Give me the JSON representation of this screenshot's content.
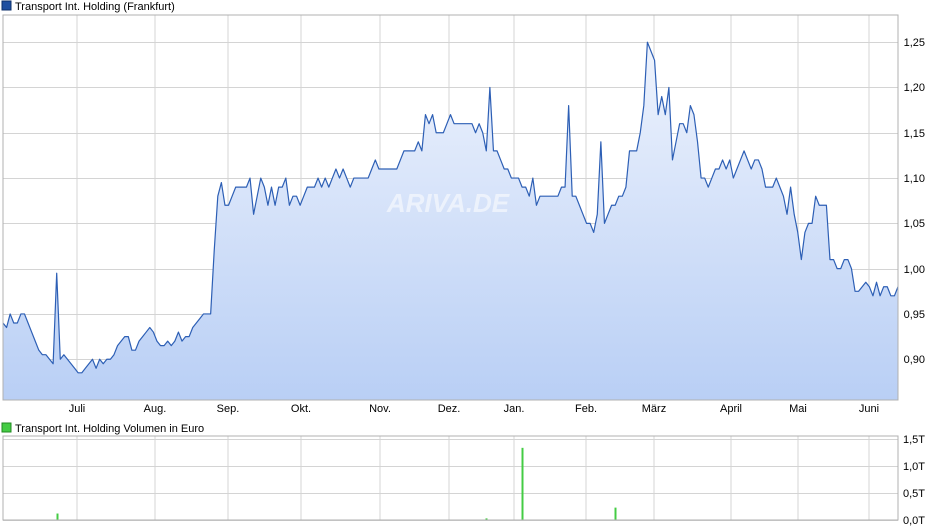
{
  "watermark": "ARIVA.DE",
  "chart_data": [
    {
      "type": "area",
      "title": "Transport Int. Holding (Frankfurt)",
      "xlabel": "",
      "ylabel": "",
      "month_labels": [
        "Juli",
        "Aug.",
        "Sep.",
        "Okt.",
        "Nov.",
        "Dez.",
        "Jan.",
        "Feb.",
        "März",
        "April",
        "Mai",
        "Juni"
      ],
      "y_tick_labels": [
        "0,90",
        "0,95",
        "1,00",
        "1,05",
        "1,10",
        "1,15",
        "1,20",
        "1,25"
      ],
      "y_ticks": [
        0.9,
        0.95,
        1.0,
        1.05,
        1.1,
        1.15,
        1.2,
        1.25
      ],
      "ylim": [
        0.855,
        1.28
      ],
      "grid": true,
      "legend_position": "top-left",
      "colors": {
        "line": "#2d5fb5",
        "fill_top": "#eef3fd",
        "fill_bottom": "#b9cff5",
        "legend": "#1f4fa0"
      },
      "series": [
        {
          "name": "Transport Int. Holding (Frankfurt)",
          "values": [
            0.94,
            0.935,
            0.95,
            0.94,
            0.94,
            0.95,
            0.95,
            0.94,
            0.93,
            0.92,
            0.91,
            0.905,
            0.905,
            0.9,
            0.895,
            0.995,
            0.9,
            0.905,
            0.9,
            0.895,
            0.89,
            0.885,
            0.885,
            0.89,
            0.895,
            0.9,
            0.89,
            0.9,
            0.895,
            0.9,
            0.9,
            0.905,
            0.915,
            0.92,
            0.925,
            0.925,
            0.91,
            0.91,
            0.92,
            0.925,
            0.93,
            0.935,
            0.93,
            0.92,
            0.915,
            0.915,
            0.92,
            0.915,
            0.92,
            0.93,
            0.92,
            0.925,
            0.925,
            0.935,
            0.94,
            0.945,
            0.95,
            0.95,
            0.95,
            1.02,
            1.08,
            1.095,
            1.07,
            1.07,
            1.08,
            1.09,
            1.09,
            1.09,
            1.09,
            1.1,
            1.06,
            1.08,
            1.1,
            1.09,
            1.07,
            1.09,
            1.07,
            1.09,
            1.09,
            1.1,
            1.07,
            1.08,
            1.08,
            1.07,
            1.08,
            1.09,
            1.09,
            1.09,
            1.1,
            1.09,
            1.1,
            1.09,
            1.1,
            1.11,
            1.1,
            1.11,
            1.1,
            1.09,
            1.1,
            1.1,
            1.1,
            1.1,
            1.1,
            1.11,
            1.12,
            1.11,
            1.11,
            1.11,
            1.11,
            1.11,
            1.11,
            1.12,
            1.13,
            1.13,
            1.13,
            1.13,
            1.14,
            1.13,
            1.17,
            1.16,
            1.17,
            1.15,
            1.15,
            1.15,
            1.16,
            1.17,
            1.16,
            1.16,
            1.16,
            1.16,
            1.16,
            1.16,
            1.15,
            1.16,
            1.15,
            1.13,
            1.2,
            1.13,
            1.13,
            1.12,
            1.11,
            1.11,
            1.1,
            1.1,
            1.1,
            1.09,
            1.09,
            1.08,
            1.1,
            1.07,
            1.08,
            1.08,
            1.08,
            1.08,
            1.08,
            1.08,
            1.09,
            1.09,
            1.18,
            1.08,
            1.08,
            1.07,
            1.06,
            1.05,
            1.05,
            1.04,
            1.06,
            1.14,
            1.05,
            1.06,
            1.07,
            1.07,
            1.08,
            1.08,
            1.09,
            1.13,
            1.13,
            1.13,
            1.15,
            1.18,
            1.25,
            1.24,
            1.23,
            1.17,
            1.19,
            1.17,
            1.2,
            1.12,
            1.14,
            1.16,
            1.16,
            1.15,
            1.18,
            1.17,
            1.14,
            1.1,
            1.1,
            1.09,
            1.1,
            1.11,
            1.11,
            1.12,
            1.11,
            1.12,
            1.1,
            1.11,
            1.12,
            1.13,
            1.12,
            1.11,
            1.12,
            1.12,
            1.11,
            1.09,
            1.09,
            1.09,
            1.1,
            1.09,
            1.08,
            1.06,
            1.09,
            1.06,
            1.04,
            1.01,
            1.04,
            1.05,
            1.05,
            1.08,
            1.07,
            1.07,
            1.07,
            1.01,
            1.01,
            1.0,
            1.0,
            1.01,
            1.01,
            1.0,
            0.975,
            0.975,
            0.98,
            0.985,
            0.98,
            0.97,
            0.985,
            0.97,
            0.98,
            0.98,
            0.97,
            0.97,
            0.98
          ]
        }
      ]
    },
    {
      "type": "bar",
      "title": "Transport Int. Holding Volumen in Euro",
      "xlabel": "",
      "ylabel": "",
      "y_tick_labels": [
        "0,0T",
        "0,5T",
        "1,0T",
        "1,5T"
      ],
      "y_ticks": [
        0,
        500,
        1000,
        1500
      ],
      "ylim": [
        0,
        1560
      ],
      "colors": {
        "bar": "#44cc44",
        "legend": "#44cc44"
      },
      "series": [
        {
          "name": "Transport Int. Holding Volumen in Euro",
          "bars": [
            {
              "i": 15,
              "value": 120
            },
            {
              "i": 135,
              "value": 30
            },
            {
              "i": 145,
              "value": 1340
            },
            {
              "i": 171,
              "value": 230
            }
          ]
        }
      ]
    }
  ]
}
